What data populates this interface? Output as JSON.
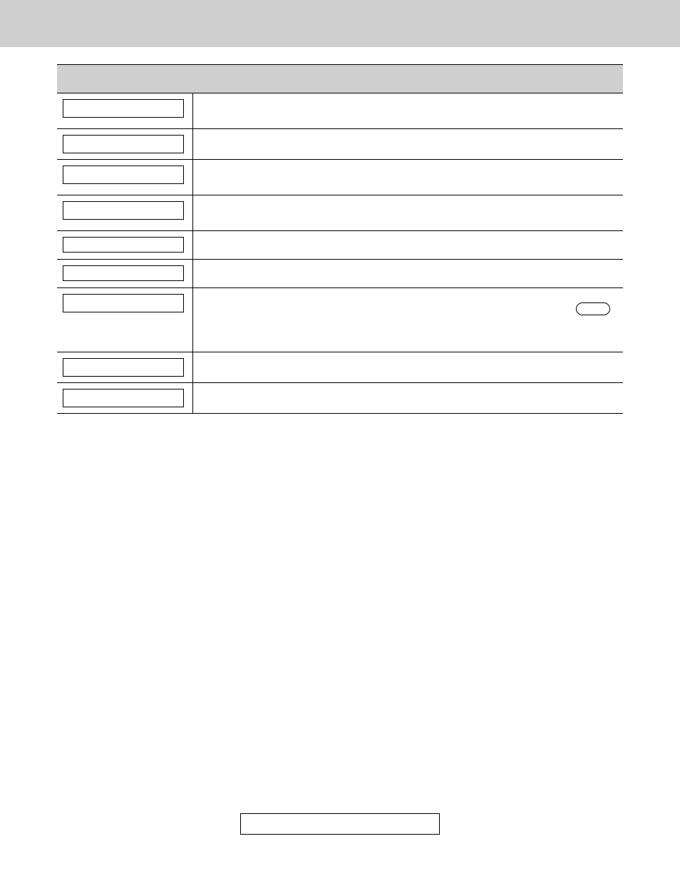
{
  "header": {
    "title": ""
  },
  "table": {
    "head": {
      "col1": "",
      "col2": ""
    },
    "rows": [
      {
        "button_label": "",
        "desc": "",
        "height": "row-tall"
      },
      {
        "button_label": "",
        "desc": "",
        "height": "row-med"
      },
      {
        "button_label": "",
        "desc": "",
        "height": "row-tall"
      },
      {
        "button_label": "",
        "desc": "",
        "height": "row-tall"
      },
      {
        "button_label": "",
        "desc": "",
        "height": "row-med"
      },
      {
        "button_label": "",
        "desc": "",
        "height": "row-med"
      },
      {
        "button_label": "",
        "desc": "",
        "height": "row-huge",
        "has_pill": true
      },
      {
        "button_label": "",
        "desc": "",
        "height": "row-med"
      },
      {
        "button_label": "",
        "desc": "",
        "height": "row-med"
      }
    ]
  },
  "footer": {
    "note": ""
  }
}
